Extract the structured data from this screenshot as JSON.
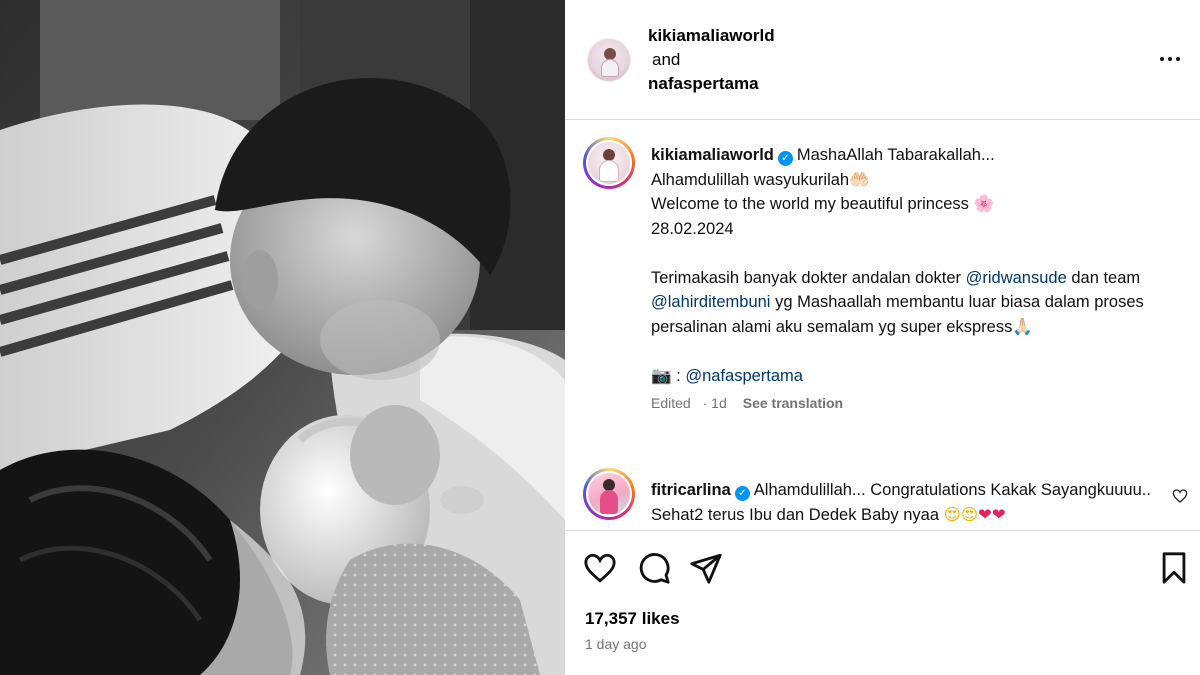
{
  "header": {
    "user1": "kikiamaliaworld",
    "and_text": "and",
    "user2": "nafaspertama"
  },
  "icons": [
    "more-icon",
    "verified-icon",
    "camera-icon",
    "heart-icon",
    "comment-icon",
    "share-icon",
    "bookmark-icon"
  ],
  "caption": {
    "username": "kikiamaliaworld",
    "line1": "MashaAllah Tabarakallah...",
    "line2": "Alhamdulillah wasyukurilah",
    "line2_emoji": "🤲🏻",
    "line3": "Welcome to the world my beautiful princess",
    "line3_emoji": "🌸",
    "line4": "28.02.2024",
    "para2_a": "Terimakasih banyak dokter andalan dokter",
    "mention1": "@ridwansude",
    "para2_b": "dan team",
    "mention2": "@lahirditembuni",
    "para3_a": "yg Mashaallah membantu luar biasa dalam proses persalinan alami aku semalam yg super ekspress",
    "para3_emoji": "🙏🏻",
    "camera_emoji": "📷",
    "camera_sep": ":",
    "mention3": "@nafaspertama",
    "edited": "Edited",
    "age": "1d",
    "see_translation": "See translation"
  },
  "comment": {
    "username": "fitricarlina",
    "text": "Alhamdulillah... Congratulations Kakak Sayangkuuuu.. Sehat2 terus Ibu dan Dedek Baby nyaa",
    "emoji_smiles": "😍😍",
    "emoji_hearts": "❤❤"
  },
  "footer": {
    "likes": "17,357 likes",
    "time": "1 day ago"
  },
  "colors": {
    "link": "#00376b",
    "verified": "#0095f6",
    "muted": "#737373",
    "divider": "#dbdbdb"
  }
}
